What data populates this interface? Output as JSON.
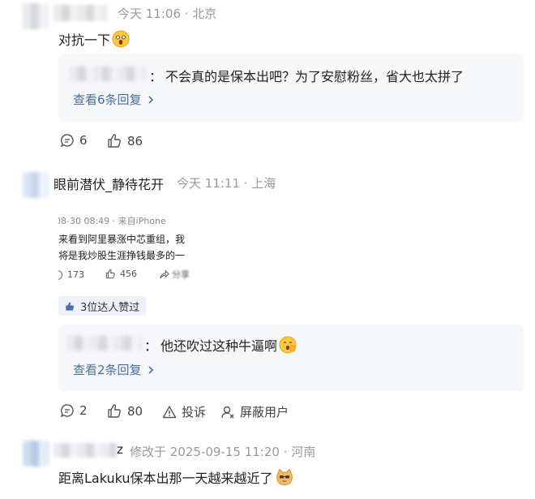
{
  "comment1": {
    "meta": "今天 11:06 · 北京",
    "text": "对抗一下",
    "reply": {
      "suffix": "：",
      "text": "不会真的是保本出吧？为了安慰粉丝，省大也太拼了"
    },
    "view_replies": "查看6条回复",
    "actions": {
      "comments": "6",
      "likes": "86"
    }
  },
  "comment2": {
    "user": "眼前潜伏_静待花开",
    "meta": "今天 11:11 · 上海",
    "screenshot": {
      "meta": "08-30 08:49 · 来自iPhone",
      "line1": "来看到阿里暴涨中芯重组，我",
      "line2": "将是我炒股生涯挣钱最多的一",
      "count1": "173",
      "count2": "456",
      "share": "分享"
    },
    "badge": "3位达人赞过",
    "reply": {
      "suffix": "：",
      "text": "他还吹过这种牛逼啊"
    },
    "view_replies": "查看2条回复",
    "actions": {
      "comments": "2",
      "likes": "80",
      "report": "投诉",
      "block": "屏蔽用户"
    }
  },
  "comment3": {
    "user_suffix": "z",
    "meta": "修改于 2025-09-15 11:20 · 河南",
    "text": "距离Lakuku保本出那一天越来越近了"
  },
  "colors": {
    "link": "#4a6fa5",
    "meta": "#999999",
    "reply_bg": "#f6f7f9"
  },
  "icons": [
    "comment-icon",
    "like-icon",
    "report-icon",
    "block-user-icon",
    "chevron-right-icon",
    "shocked-emoji-icon",
    "cat-emoji-icon",
    "thumb-badge-icon"
  ]
}
